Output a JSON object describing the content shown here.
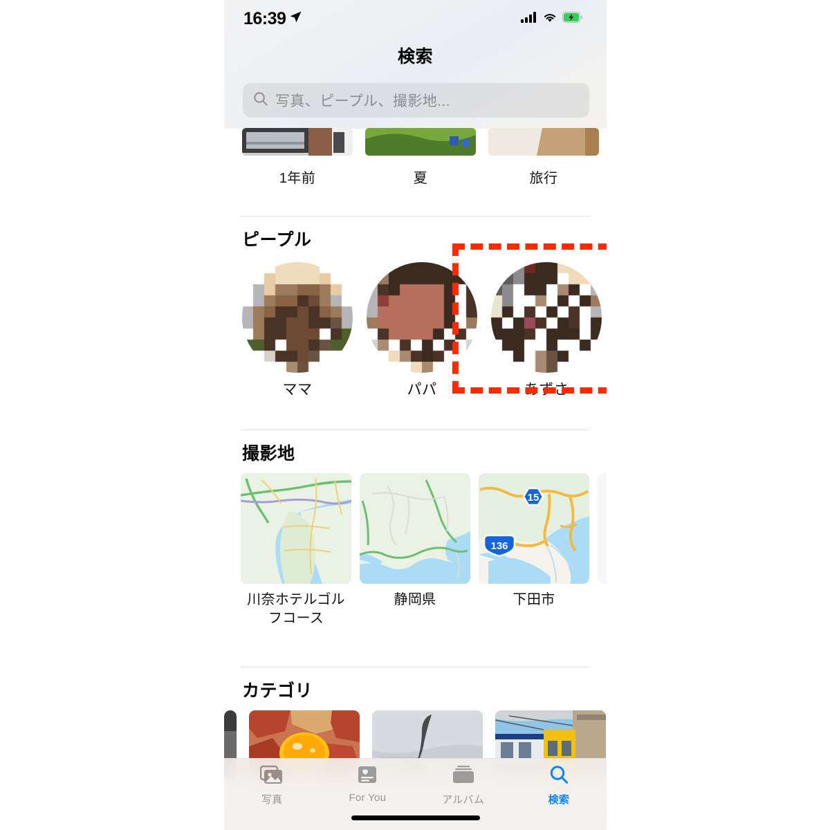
{
  "status_bar": {
    "time": "16:39",
    "location_icon": "location-arrow-icon",
    "cellular_icon": "cellular-bars-icon",
    "wifi_icon": "wifi-icon",
    "battery_icon": "battery-charging-icon"
  },
  "nav": {
    "title": "検索"
  },
  "search": {
    "icon": "search-icon",
    "placeholder": "写真、ピープル、撮影地...",
    "value": ""
  },
  "sections": {
    "memories": {
      "items": [
        {
          "label": "1年前"
        },
        {
          "label": "夏"
        },
        {
          "label": "旅行"
        }
      ]
    },
    "people": {
      "title": "ピープル",
      "items": [
        {
          "label": "ママ"
        },
        {
          "label": "パパ"
        },
        {
          "label": "あずさ"
        }
      ]
    },
    "places": {
      "title": "撮影地",
      "items": [
        {
          "label": "川奈ホテルゴルフコース",
          "route_shields": []
        },
        {
          "label": "静岡県",
          "route_shields": []
        },
        {
          "label": "下田市",
          "route_shields": [
            "15",
            "136"
          ]
        }
      ]
    },
    "categories": {
      "title": "カテゴリ",
      "items": [
        {
          "label": ""
        },
        {
          "label": ""
        },
        {
          "label": ""
        }
      ]
    }
  },
  "tab_bar": {
    "items": [
      {
        "label": "写真",
        "icon": "photos-icon",
        "active": false
      },
      {
        "label": "For You",
        "icon": "for-you-heart-card-icon",
        "active": false
      },
      {
        "label": "アルバム",
        "icon": "albums-icon",
        "active": false
      },
      {
        "label": "検索",
        "icon": "search-icon",
        "active": true
      }
    ]
  },
  "annotation": {
    "shape": "red-dashed-rectangle",
    "target": "ピープル",
    "color": "#f92b00"
  },
  "colors": {
    "accent": "#0a84ff",
    "annotation_red": "#f92b00",
    "tab_inactive": "#9b938e",
    "placeholder_gray": "#8c8c92"
  }
}
